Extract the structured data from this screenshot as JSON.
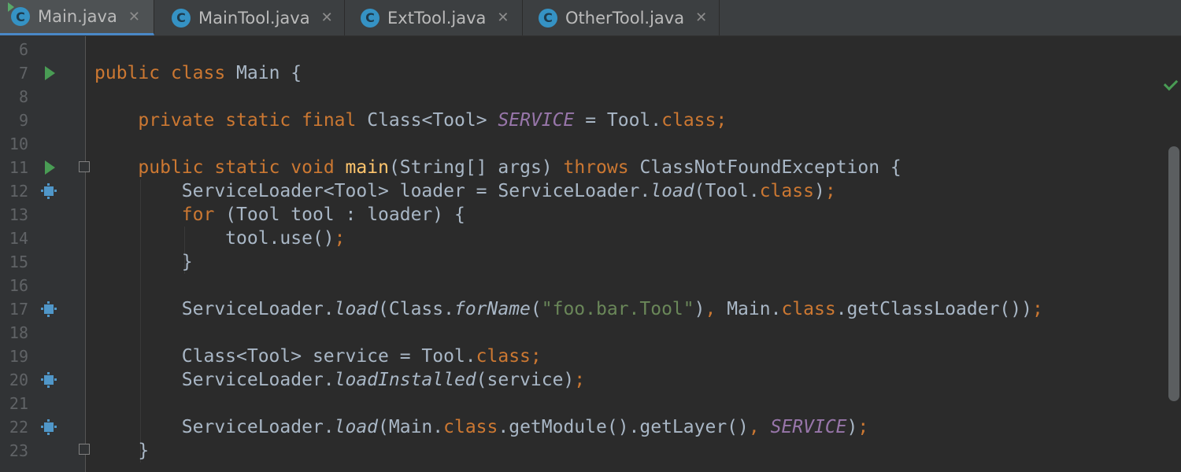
{
  "tabs": [
    {
      "label": "Main.java",
      "icon": "class-c-icon",
      "active": true
    },
    {
      "label": "MainTool.java",
      "icon": "class-c-icon",
      "active": false
    },
    {
      "label": "ExtTool.java",
      "icon": "class-c-icon",
      "active": false
    },
    {
      "label": "OtherTool.java",
      "icon": "class-c-icon",
      "active": false
    }
  ],
  "tab_close_symbol": "✕",
  "class_icon_letter": "C",
  "line_numbers": [
    "6",
    "7",
    "8",
    "9",
    "10",
    "11",
    "12",
    "13",
    "14",
    "15",
    "16",
    "17",
    "18",
    "19",
    "20",
    "21",
    "22",
    "23"
  ],
  "code": {
    "l6": "",
    "l7": "public class Main {",
    "l8": "",
    "l9": "    private static final Class<Tool> SERVICE = Tool.class;",
    "l10": "",
    "l11": "    public static void main(String[] args) throws ClassNotFoundException {",
    "l12": "        ServiceLoader<Tool> loader = ServiceLoader.load(Tool.class);",
    "l13": "        for (Tool tool : loader) {",
    "l14": "            tool.use();",
    "l15": "        }",
    "l16": "",
    "l17": "        ServiceLoader.load(Class.forName(\"foo.bar.Tool\"), Main.class.getClassLoader());",
    "l18": "",
    "l19": "        Class<Tool> service = Tool.class;",
    "l20": "        ServiceLoader.loadInstalled(service);",
    "l21": "",
    "l22": "        ServiceLoader.load(Main.class.getModule().getLayer(), SERVICE);",
    "l23": "    }"
  },
  "tokens": {
    "public": "public",
    "class": "class",
    "private": "private",
    "static": "static",
    "final": "final",
    "void": "void",
    "throws": "throws",
    "for": "for",
    "Main": "Main",
    "SERVICE": "SERVICE",
    "main": "main",
    "load": "load",
    "forName": "forName",
    "loadInstalled": "loadInstalled",
    "str_foo": "\"foo.bar.Tool\""
  },
  "colors": {
    "background": "#2b2b2b",
    "keyword": "#cc7832",
    "method_decl": "#ffc66d",
    "constant": "#9876aa",
    "string": "#6a8759",
    "text": "#a9b7c6",
    "run_icon": "#499c54",
    "impl_icon": "#5097c9"
  }
}
